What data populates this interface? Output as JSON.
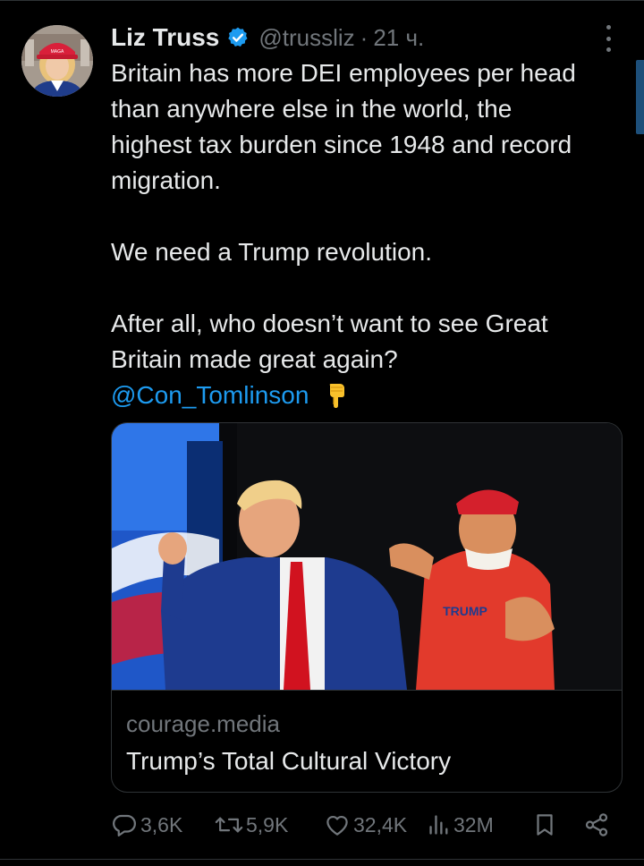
{
  "tweet": {
    "author_name": "Liz Truss",
    "handle": "@trussliz",
    "separator": "·",
    "time": "21 ч.",
    "text": {
      "line1": "Britain has more DEI employees per head",
      "line2": "than anywhere else in the world, the",
      "line3": "highest tax burden since 1948 and record",
      "line4": "migration.",
      "line5": "We need a Trump revolution.",
      "line6": "After all, who doesn’t want to see Great",
      "line7": "Britain made great again?",
      "mention": "@Con_Tomlinson"
    }
  },
  "link_card": {
    "domain": "courage.media",
    "title": "Trump’s Total Cultural Victory",
    "image_caption_text": "TRUMP"
  },
  "actions": {
    "replies": "3,6K",
    "reposts": "5,9K",
    "likes": "32,4K",
    "views": "32M"
  },
  "colors": {
    "background": "#000000",
    "text": "#e7e9ea",
    "muted": "#71767b",
    "link": "#1d9bf0",
    "verified": "#1d9bf0",
    "border": "#2f3336"
  },
  "icons": {
    "verified": "verified-badge-icon",
    "more": "more-vertical-icon",
    "point": "pointing-down-emoji-icon",
    "reply": "reply-icon",
    "repost": "repost-icon",
    "like": "heart-icon",
    "views": "views-icon",
    "bookmark": "bookmark-icon",
    "share": "share-icon"
  }
}
